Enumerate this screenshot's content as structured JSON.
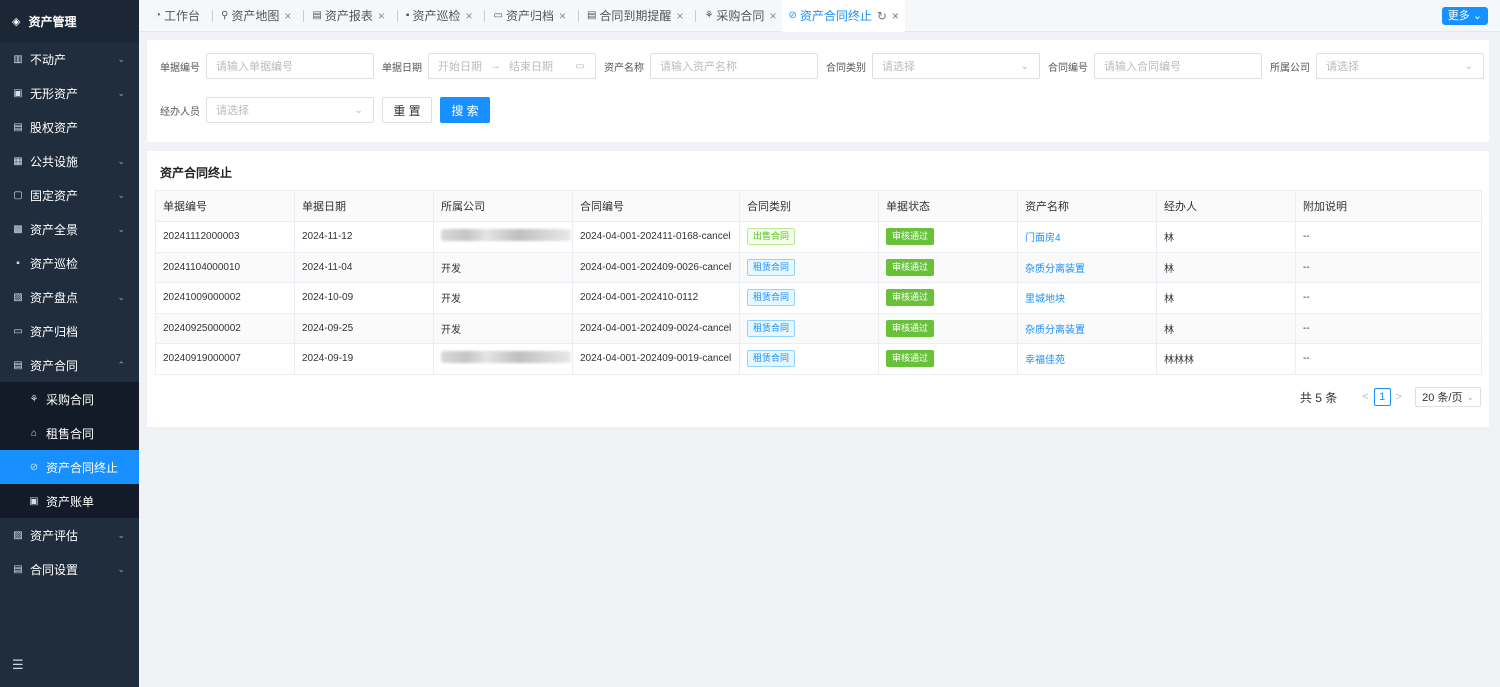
{
  "sidebar": {
    "logo": "资产管理",
    "items": [
      {
        "label": "不动产",
        "icon": "building-icon",
        "glyph": "▥",
        "chevron": "⌄"
      },
      {
        "label": "无形资产",
        "icon": "intangible-icon",
        "glyph": "▣",
        "chevron": "⌄"
      },
      {
        "label": "股权资产",
        "icon": "equity-icon",
        "glyph": "▤",
        "chevron": ""
      },
      {
        "label": "公共设施",
        "icon": "facility-icon",
        "glyph": "▦",
        "chevron": "⌄"
      },
      {
        "label": "固定资产",
        "icon": "fixed-asset-icon",
        "glyph": "▢",
        "chevron": "⌄"
      },
      {
        "label": "资产全景",
        "icon": "panorama-icon",
        "glyph": "▩",
        "chevron": "⌄"
      },
      {
        "label": "资产巡检",
        "icon": "inspection-icon",
        "glyph": "▪",
        "chevron": ""
      },
      {
        "label": "资产盘点",
        "icon": "inventory-icon",
        "glyph": "▧",
        "chevron": "⌄"
      },
      {
        "label": "资产归档",
        "icon": "archive-icon",
        "glyph": "▭",
        "chevron": ""
      },
      {
        "label": "资产合同",
        "icon": "contract-icon",
        "glyph": "▤",
        "chevron": "⌃"
      }
    ],
    "submenu": [
      {
        "label": "采购合同",
        "icon": "purchase-icon",
        "glyph": "⚘"
      },
      {
        "label": "租售合同",
        "icon": "lease-icon",
        "glyph": "⌂"
      },
      {
        "label": "资产合同终止",
        "icon": "terminate-icon",
        "glyph": "⊘"
      },
      {
        "label": "资产账单",
        "icon": "bill-icon",
        "glyph": "▣"
      }
    ],
    "items_after": [
      {
        "label": "资产评估",
        "icon": "evaluation-icon",
        "glyph": "▨",
        "chevron": "⌄"
      },
      {
        "label": "合同设置",
        "icon": "settings-icon",
        "glyph": "▤",
        "chevron": "⌄"
      }
    ]
  },
  "tabs": [
    {
      "label": "工作台",
      "icon": "dashboard-icon",
      "glyph": "◔",
      "close": false
    },
    {
      "label": "资产地图",
      "icon": "map-icon",
      "glyph": "⚲",
      "close": true
    },
    {
      "label": "资产报表",
      "icon": "report-icon",
      "glyph": "▤",
      "close": true
    },
    {
      "label": "资产巡检",
      "icon": "inspection-icon",
      "glyph": "▪",
      "close": true
    },
    {
      "label": "资产归档",
      "icon": "archive-icon",
      "glyph": "▭",
      "close": true
    },
    {
      "label": "合同到期提醒",
      "icon": "reminder-icon",
      "glyph": "▤",
      "close": true
    },
    {
      "label": "采购合同",
      "icon": "purchase-icon",
      "glyph": "⚘",
      "close": true
    },
    {
      "label": "资产合同终止",
      "icon": "terminate-icon",
      "glyph": "⊘",
      "close": true,
      "active": true
    }
  ],
  "more_label": "更多",
  "filters": {
    "doc_no": {
      "label": "单据编号",
      "placeholder": "请输入单据编号"
    },
    "doc_date": {
      "label": "单据日期",
      "start": "开始日期",
      "end": "结束日期"
    },
    "asset_name": {
      "label": "资产名称",
      "placeholder": "请输入资产名称"
    },
    "contract_type": {
      "label": "合同类别",
      "placeholder": "请选择"
    },
    "contract_no": {
      "label": "合同编号",
      "placeholder": "请输入合同编号"
    },
    "company": {
      "label": "所属公司",
      "placeholder": "请选择"
    },
    "handler": {
      "label": "经办人员",
      "placeholder": "请选择"
    },
    "reset_label": "重 置",
    "search_label": "搜 索"
  },
  "table": {
    "title": "资产合同终止",
    "columns": [
      "单据编号",
      "单据日期",
      "所属公司",
      "合同编号",
      "合同类别",
      "单据状态",
      "资产名称",
      "经办人",
      "附加说明"
    ],
    "rows": [
      {
        "doc_no": "20241112000003",
        "date": "2024-11-12",
        "company": "",
        "company_blurred": true,
        "contract_no": "2024-04-001-202411-0168-cancel",
        "type": "出售合同",
        "type_kind": "sale",
        "status": "审核通过",
        "asset": "门面房4",
        "handler": "林",
        "note": "--"
      },
      {
        "doc_no": "20241104000010",
        "date": "2024-11-04",
        "company": "开发",
        "company_blurred": false,
        "contract_no": "2024-04-001-202409-0026-cancel",
        "type": "租赁合同",
        "type_kind": "rent",
        "status": "审核通过",
        "asset": "杂质分离装置",
        "handler": "林",
        "note": "--"
      },
      {
        "doc_no": "20241009000002",
        "date": "2024-10-09",
        "company": "开发",
        "company_blurred": false,
        "contract_no": "2024-04-001-202410-0112",
        "type": "租赁合同",
        "type_kind": "rent",
        "status": "审核通过",
        "asset": "里城地块",
        "handler": "林",
        "note": "--"
      },
      {
        "doc_no": "20240925000002",
        "date": "2024-09-25",
        "company": "开发",
        "company_blurred": false,
        "contract_no": "2024-04-001-202409-0024-cancel",
        "type": "租赁合同",
        "type_kind": "rent",
        "status": "审核通过",
        "asset": "杂质分离装置",
        "handler": "林",
        "note": "--"
      },
      {
        "doc_no": "20240919000007",
        "date": "2024-09-19",
        "company": "",
        "company_blurred": true,
        "contract_no": "2024-04-001-202409-0019-cancel",
        "type": "租赁合同",
        "type_kind": "rent",
        "status": "审核通过",
        "asset": "幸福佳苑",
        "handler": "林林林",
        "note": "--"
      }
    ]
  },
  "pagination": {
    "total": "共 5 条",
    "current": "1",
    "page_size": "20 条/页"
  }
}
